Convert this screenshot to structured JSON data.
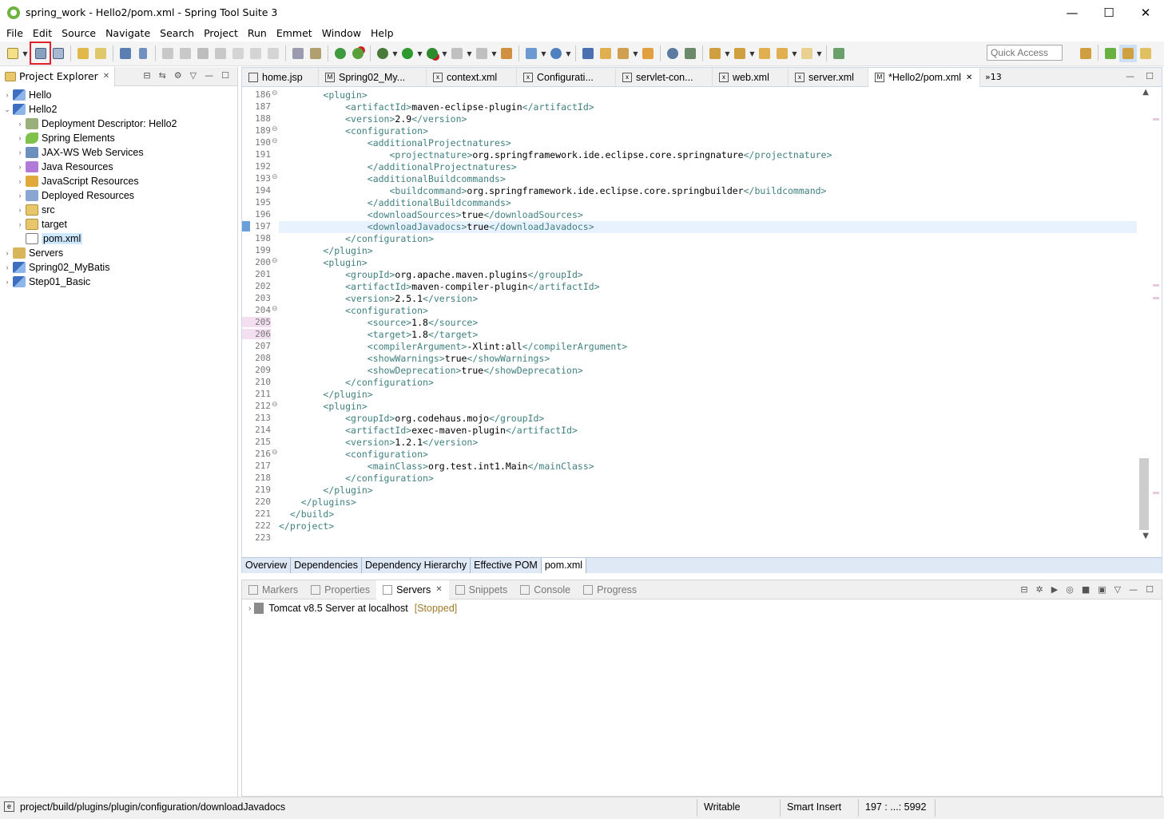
{
  "window": {
    "title": "spring_work - Hello2/pom.xml - Spring Tool Suite 3",
    "controls": [
      "—",
      "☐",
      "✕"
    ]
  },
  "menu": [
    "File",
    "Edit",
    "Source",
    "Navigate",
    "Search",
    "Project",
    "Run",
    "Emmet",
    "Window",
    "Help"
  ],
  "toolbar": {
    "quick_access_placeholder": "Quick Access",
    "highlighted_icon": "save-icon"
  },
  "project_explorer": {
    "title": "Project Explorer",
    "items": [
      {
        "label": "Hello",
        "icon": "project-icon",
        "level": 0,
        "expanded": false
      },
      {
        "label": "Hello2",
        "icon": "project-icon",
        "level": 0,
        "expanded": true
      },
      {
        "label": "Deployment Descriptor: Hello2",
        "icon": "descriptor-icon",
        "level": 1,
        "expanded": false
      },
      {
        "label": "Spring Elements",
        "icon": "spring-leaf-icon",
        "level": 1,
        "expanded": false
      },
      {
        "label": "JAX-WS Web Services",
        "icon": "webservice-icon",
        "level": 1,
        "expanded": false
      },
      {
        "label": "Java Resources",
        "icon": "java-resources-icon",
        "level": 1,
        "expanded": false
      },
      {
        "label": "JavaScript Resources",
        "icon": "js-resources-icon",
        "level": 1,
        "expanded": false
      },
      {
        "label": "Deployed Resources",
        "icon": "deployed-icon",
        "level": 1,
        "expanded": false
      },
      {
        "label": "src",
        "icon": "folder-icon",
        "level": 1,
        "expanded": false
      },
      {
        "label": "target",
        "icon": "folder-icon",
        "level": 1,
        "expanded": false
      },
      {
        "label": "pom.xml",
        "icon": "xml-file-icon",
        "level": 1,
        "leaf": true,
        "selected": true
      },
      {
        "label": "Servers",
        "icon": "servers-folder-icon",
        "level": 0,
        "expanded": false
      },
      {
        "label": "Spring02_MyBatis",
        "icon": "project-icon",
        "level": 0,
        "expanded": false
      },
      {
        "label": "Step01_Basic",
        "icon": "project-icon",
        "level": 0,
        "expanded": false
      }
    ]
  },
  "editor": {
    "tabs": [
      {
        "label": "home.jsp",
        "icon": "jsp-icon",
        "active": false
      },
      {
        "label": "Spring02_My...",
        "icon": "maven-icon",
        "active": false
      },
      {
        "label": "context.xml",
        "icon": "xml-icon",
        "active": false
      },
      {
        "label": "Configurati...",
        "icon": "xml-icon",
        "active": false
      },
      {
        "label": "servlet-con...",
        "icon": "xml-icon",
        "active": false
      },
      {
        "label": "web.xml",
        "icon": "xml-icon",
        "active": false
      },
      {
        "label": "server.xml",
        "icon": "xml-icon",
        "active": false
      },
      {
        "label": "*Hello2/pom.xml",
        "icon": "maven-icon",
        "active": true
      }
    ],
    "overflow": "»13",
    "current_line": "197",
    "lines": [
      {
        "n": "186",
        "fold": true,
        "indent": "        ",
        "parts": [
          [
            "tag",
            "<plugin>"
          ]
        ]
      },
      {
        "n": "187",
        "indent": "            ",
        "parts": [
          [
            "tag",
            "<artifactId>"
          ],
          [
            "txt",
            "maven-eclipse-plugin"
          ],
          [
            "tag",
            "</artifactId>"
          ]
        ]
      },
      {
        "n": "188",
        "indent": "            ",
        "parts": [
          [
            "tag",
            "<version>"
          ],
          [
            "txt",
            "2.9"
          ],
          [
            "tag",
            "</version>"
          ]
        ]
      },
      {
        "n": "189",
        "fold": true,
        "indent": "            ",
        "parts": [
          [
            "tag",
            "<configuration>"
          ]
        ]
      },
      {
        "n": "190",
        "fold": true,
        "indent": "                ",
        "parts": [
          [
            "tag",
            "<additionalProjectnatures>"
          ]
        ]
      },
      {
        "n": "191",
        "indent": "                    ",
        "parts": [
          [
            "tag",
            "<projectnature>"
          ],
          [
            "txt",
            "org.springframework.ide.eclipse.core.springnature"
          ],
          [
            "tag",
            "</projectnature>"
          ]
        ]
      },
      {
        "n": "192",
        "indent": "                ",
        "parts": [
          [
            "tag",
            "</additionalProjectnatures>"
          ]
        ]
      },
      {
        "n": "193",
        "fold": true,
        "indent": "                ",
        "parts": [
          [
            "tag",
            "<additionalBuildcommands>"
          ]
        ]
      },
      {
        "n": "194",
        "indent": "                    ",
        "parts": [
          [
            "tag",
            "<buildcommand>"
          ],
          [
            "txt",
            "org.springframework.ide.eclipse.core.springbuilder"
          ],
          [
            "tag",
            "</buildcommand>"
          ]
        ]
      },
      {
        "n": "195",
        "indent": "                ",
        "parts": [
          [
            "tag",
            "</additionalBuildcommands>"
          ]
        ]
      },
      {
        "n": "196",
        "indent": "                ",
        "parts": [
          [
            "tag",
            "<downloadSources>"
          ],
          [
            "txt",
            "true"
          ],
          [
            "tag",
            "</downloadSources>"
          ]
        ]
      },
      {
        "n": "197",
        "indent": "                ",
        "parts": [
          [
            "tag",
            "<downloadJavadocs>"
          ],
          [
            "txt",
            "true"
          ],
          [
            "tag",
            "</downloadJavadocs>"
          ]
        ]
      },
      {
        "n": "198",
        "indent": "            ",
        "parts": [
          [
            "tag",
            "</configuration>"
          ]
        ]
      },
      {
        "n": "199",
        "indent": "        ",
        "parts": [
          [
            "tag",
            "</plugin>"
          ]
        ]
      },
      {
        "n": "200",
        "fold": true,
        "indent": "        ",
        "parts": [
          [
            "tag",
            "<plugin>"
          ]
        ]
      },
      {
        "n": "201",
        "indent": "            ",
        "parts": [
          [
            "tag",
            "<groupId>"
          ],
          [
            "txt",
            "org.apache.maven.plugins"
          ],
          [
            "tag",
            "</groupId>"
          ]
        ]
      },
      {
        "n": "202",
        "indent": "            ",
        "parts": [
          [
            "tag",
            "<artifactId>"
          ],
          [
            "txt",
            "maven-compiler-plugin"
          ],
          [
            "tag",
            "</artifactId>"
          ]
        ]
      },
      {
        "n": "203",
        "indent": "            ",
        "parts": [
          [
            "tag",
            "<version>"
          ],
          [
            "txt",
            "2.5.1"
          ],
          [
            "tag",
            "</version>"
          ]
        ]
      },
      {
        "n": "204",
        "fold": true,
        "indent": "            ",
        "parts": [
          [
            "tag",
            "<configuration>"
          ]
        ]
      },
      {
        "n": "205",
        "indent": "                ",
        "parts": [
          [
            "tag",
            "<source>"
          ],
          [
            "txt",
            "1.8"
          ],
          [
            "tag",
            "</source>"
          ]
        ]
      },
      {
        "n": "206",
        "indent": "                ",
        "parts": [
          [
            "tag",
            "<target>"
          ],
          [
            "txt",
            "1.8"
          ],
          [
            "tag",
            "</target>"
          ]
        ]
      },
      {
        "n": "207",
        "indent": "                ",
        "parts": [
          [
            "tag",
            "<compilerArgument>"
          ],
          [
            "txt",
            "-Xlint:all"
          ],
          [
            "tag",
            "</compilerArgument>"
          ]
        ]
      },
      {
        "n": "208",
        "indent": "                ",
        "parts": [
          [
            "tag",
            "<showWarnings>"
          ],
          [
            "txt",
            "true"
          ],
          [
            "tag",
            "</showWarnings>"
          ]
        ]
      },
      {
        "n": "209",
        "indent": "                ",
        "parts": [
          [
            "tag",
            "<showDeprecation>"
          ],
          [
            "txt",
            "true"
          ],
          [
            "tag",
            "</showDeprecation>"
          ]
        ]
      },
      {
        "n": "210",
        "indent": "            ",
        "parts": [
          [
            "tag",
            "</configuration>"
          ]
        ]
      },
      {
        "n": "211",
        "indent": "        ",
        "parts": [
          [
            "tag",
            "</plugin>"
          ]
        ]
      },
      {
        "n": "212",
        "fold": true,
        "indent": "        ",
        "parts": [
          [
            "tag",
            "<plugin>"
          ]
        ]
      },
      {
        "n": "213",
        "indent": "            ",
        "parts": [
          [
            "tag",
            "<groupId>"
          ],
          [
            "txt",
            "org.codehaus.mojo"
          ],
          [
            "tag",
            "</groupId>"
          ]
        ]
      },
      {
        "n": "214",
        "indent": "            ",
        "parts": [
          [
            "tag",
            "<artifactId>"
          ],
          [
            "txt",
            "exec-maven-plugin"
          ],
          [
            "tag",
            "</artifactId>"
          ]
        ]
      },
      {
        "n": "215",
        "indent": "            ",
        "parts": [
          [
            "tag",
            "<version>"
          ],
          [
            "txt",
            "1.2.1"
          ],
          [
            "tag",
            "</version>"
          ]
        ]
      },
      {
        "n": "216",
        "fold": true,
        "indent": "            ",
        "parts": [
          [
            "tag",
            "<configuration>"
          ]
        ]
      },
      {
        "n": "217",
        "indent": "                ",
        "parts": [
          [
            "tag",
            "<mainClass>"
          ],
          [
            "txt",
            "org.test.int1.Main"
          ],
          [
            "tag",
            "</mainClass>"
          ]
        ]
      },
      {
        "n": "218",
        "indent": "            ",
        "parts": [
          [
            "tag",
            "</configuration>"
          ]
        ]
      },
      {
        "n": "219",
        "indent": "        ",
        "parts": [
          [
            "tag",
            "</plugin>"
          ]
        ]
      },
      {
        "n": "220",
        "indent": "    ",
        "parts": [
          [
            "tag",
            "</plugins>"
          ]
        ]
      },
      {
        "n": "221",
        "indent": "  ",
        "parts": [
          [
            "tag",
            "</build>"
          ]
        ]
      },
      {
        "n": "222",
        "indent": "",
        "parts": [
          [
            "tag",
            "</project>"
          ]
        ]
      },
      {
        "n": "223",
        "indent": "",
        "parts": []
      }
    ],
    "pom_tabs": [
      "Overview",
      "Dependencies",
      "Dependency Hierarchy",
      "Effective POM",
      "pom.xml"
    ],
    "active_pom_tab": "pom.xml"
  },
  "bottom_panel": {
    "tabs": [
      {
        "label": "Markers",
        "active": false
      },
      {
        "label": "Properties",
        "active": false
      },
      {
        "label": "Servers",
        "active": true
      },
      {
        "label": "Snippets",
        "active": false
      },
      {
        "label": "Console",
        "active": false
      },
      {
        "label": "Progress",
        "active": false
      }
    ],
    "server": {
      "name": "Tomcat v8.5 Server at localhost",
      "status": "[Stopped]"
    }
  },
  "status_bar": {
    "path": "project/build/plugins/plugin/configuration/downloadJavadocs",
    "mode": "Writable",
    "insert": "Smart Insert",
    "position": "197 : ...: 5992"
  },
  "colors": {
    "tag": "#3f7f7f",
    "current_line": "#e8f2fe",
    "highlight_border": "#e0202a"
  }
}
